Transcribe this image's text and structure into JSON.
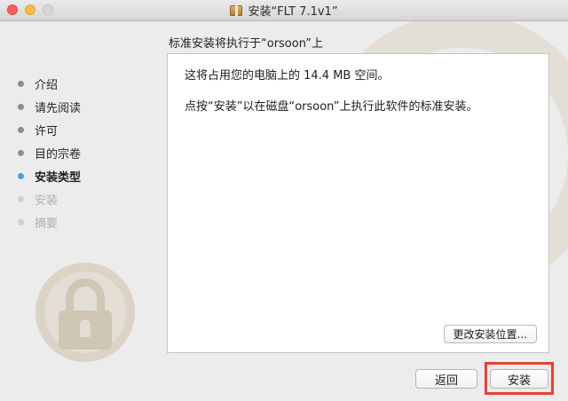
{
  "window": {
    "title": "安装“FLT 7.1v1”",
    "title_icon": "package-icon"
  },
  "sidebar": {
    "steps": [
      {
        "label": "介绍",
        "state": "done"
      },
      {
        "label": "请先阅读",
        "state": "done"
      },
      {
        "label": "许可",
        "state": "done"
      },
      {
        "label": "目的宗卷",
        "state": "done"
      },
      {
        "label": "安装类型",
        "state": "current"
      },
      {
        "label": "安装",
        "state": "future"
      },
      {
        "label": "摘要",
        "state": "future"
      }
    ]
  },
  "main": {
    "heading": "标准安装将执行于“orsoon”上",
    "line1": "这将占用您的电脑上的 14.4 MB 空间。",
    "line2": "点按“安装”以在磁盘“orsoon”上执行此软件的标准安装。",
    "change_location_label": "更改安装位置..."
  },
  "footer": {
    "back_label": "返回",
    "install_label": "安装"
  },
  "colors": {
    "current_step_dot": "#4b9bee",
    "highlight_border": "#e8412f"
  }
}
